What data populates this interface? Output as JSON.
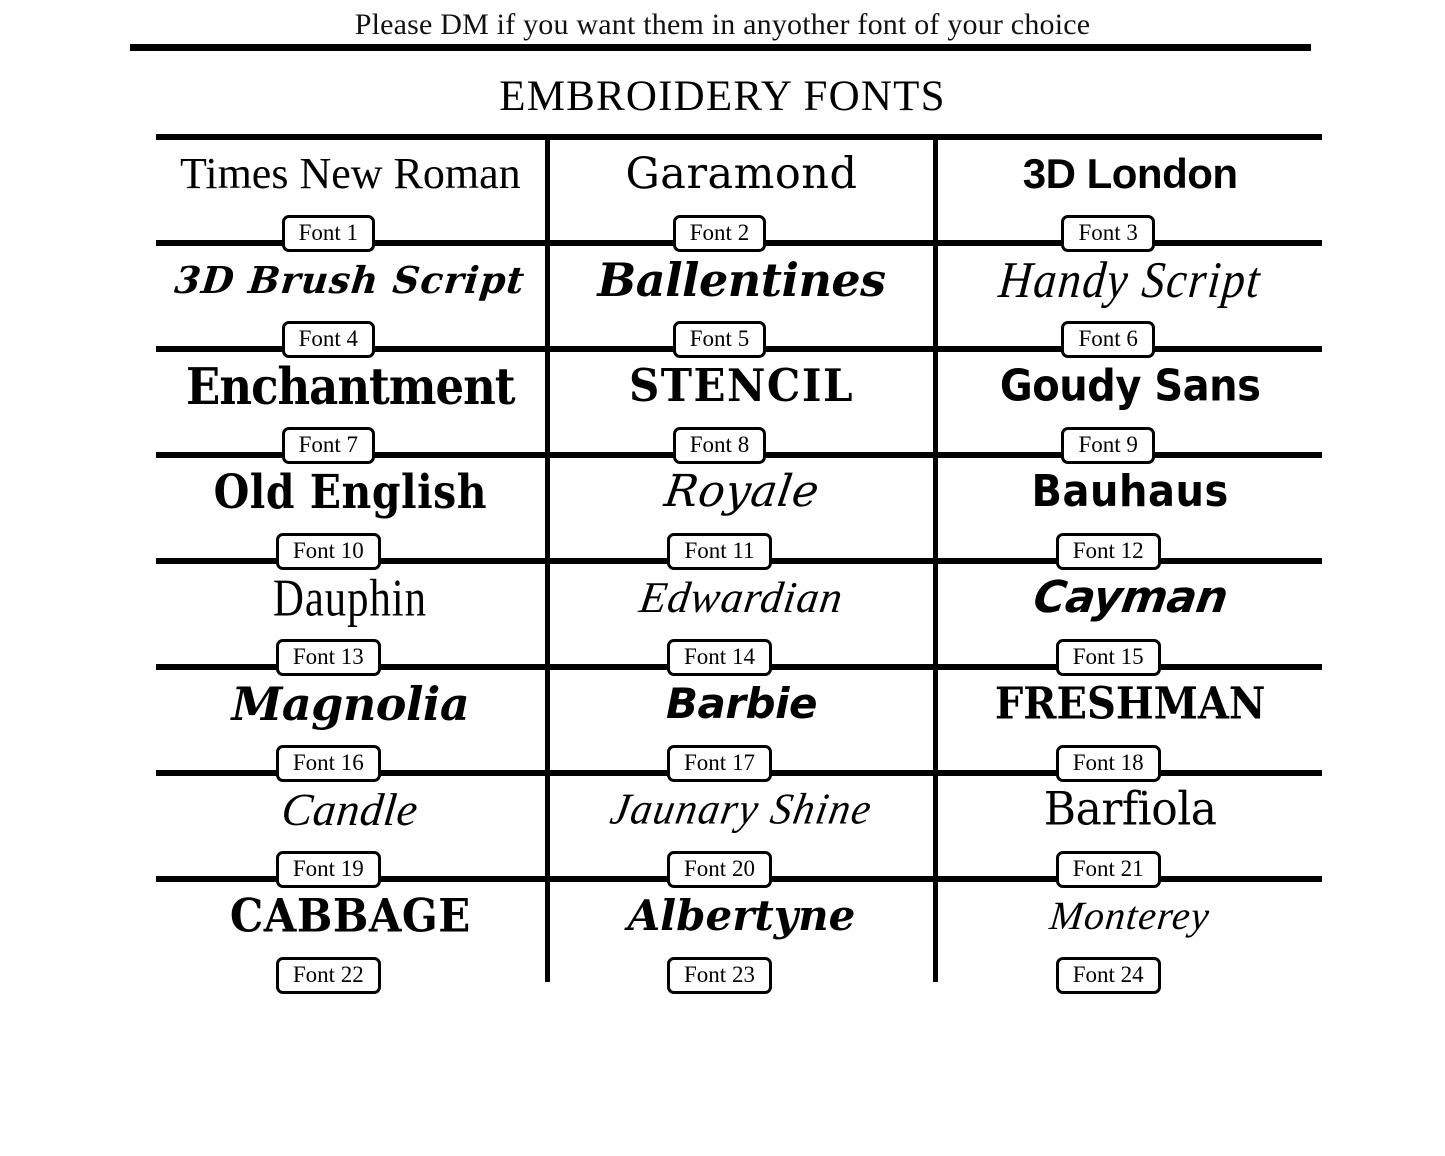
{
  "header": {
    "note": "Please DM if you want them in anyother font of your choice",
    "title": "EMBROIDERY FONTS"
  },
  "colors": {
    "ink": "#000000",
    "background": "#ffffff"
  },
  "table": {
    "columns": 3,
    "rows": 8,
    "cells": [
      {
        "sample": "Times New Roman",
        "badge": "Font 1",
        "style": "f-times"
      },
      {
        "sample": "Garamond",
        "badge": "Font 2",
        "style": "f-garamond"
      },
      {
        "sample": "3D London",
        "badge": "Font 3",
        "style": "f-3dlondon"
      },
      {
        "sample": "3D Brush Script",
        "badge": "Font 4",
        "style": "f-3dbrush"
      },
      {
        "sample": "Ballentines",
        "badge": "Font 5",
        "style": "f-ballentine"
      },
      {
        "sample": "Handy Script",
        "badge": "Font 6",
        "style": "f-handy"
      },
      {
        "sample": "Enchantment",
        "badge": "Font 7",
        "style": "f-enchant"
      },
      {
        "sample": "STENCIL",
        "badge": "Font 8",
        "style": "f-stencil"
      },
      {
        "sample": "Goudy Sans",
        "badge": "Font 9",
        "style": "f-goudy"
      },
      {
        "sample": "Old English",
        "badge": "Font 10",
        "style": "f-oldeng"
      },
      {
        "sample": "Royale",
        "badge": "Font 11",
        "style": "f-royale"
      },
      {
        "sample": "Bauhaus",
        "badge": "Font 12",
        "style": "f-bauhaus"
      },
      {
        "sample": "Dauphin",
        "badge": "Font 13",
        "style": "f-dauphin"
      },
      {
        "sample": "Edwardian",
        "badge": "Font 14",
        "style": "f-edwardian"
      },
      {
        "sample": "Cayman",
        "badge": "Font 15",
        "style": "f-cayman"
      },
      {
        "sample": "Magnolia",
        "badge": "Font 16",
        "style": "f-magnolia"
      },
      {
        "sample": "Barbie",
        "badge": "Font 17",
        "style": "f-barbie"
      },
      {
        "sample": "FRESHMAN",
        "badge": "Font 18",
        "style": "f-freshman"
      },
      {
        "sample": "Candle",
        "badge": "Font 19",
        "style": "f-candle"
      },
      {
        "sample": "Jaunary Shine",
        "badge": "Font 20",
        "style": "f-jaunary"
      },
      {
        "sample": "Barfiola",
        "badge": "Font 21",
        "style": "f-barfiola"
      },
      {
        "sample": "CABBAGE",
        "badge": "Font 22",
        "style": "f-cabbage"
      },
      {
        "sample": "Albertyne",
        "badge": "Font 23",
        "style": "f-albertyne"
      },
      {
        "sample": "Monterey",
        "badge": "Font 24",
        "style": "f-monterey"
      }
    ]
  }
}
